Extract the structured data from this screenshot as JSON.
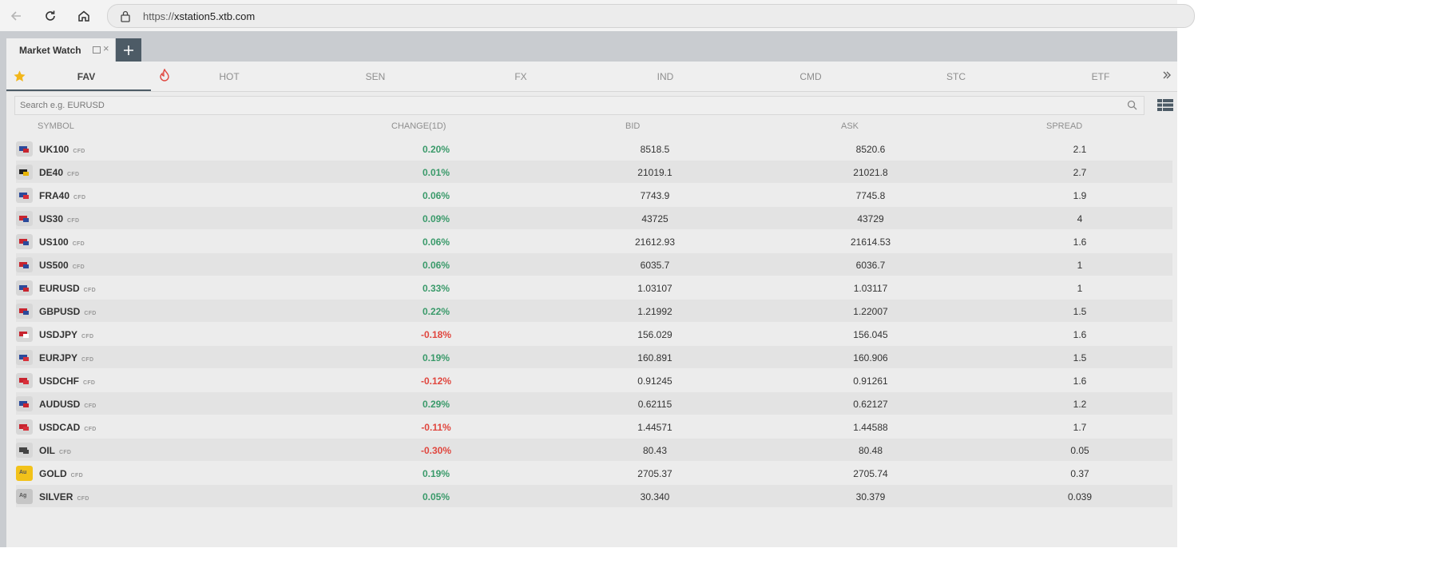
{
  "browser": {
    "url_scheme": "https://",
    "url_host": "xstation5.xtb.com"
  },
  "tabs": {
    "market_watch": "Market Watch"
  },
  "categories": [
    "FAV",
    "HOT",
    "SEN",
    "FX",
    "IND",
    "CMD",
    "STC",
    "ETF"
  ],
  "search": {
    "placeholder": "Search e.g. EURUSD"
  },
  "columns": {
    "symbol": "SYMBOL",
    "change": "CHANGE(1D)",
    "bid": "BID",
    "ask": "ASK",
    "spread": "SPREAD"
  },
  "colors": {
    "positive": "#3a9a6a",
    "negative": "#e0463e",
    "accent": "#4d5b66",
    "star": "#f2b61a"
  },
  "rows": [
    {
      "symbol": "UK100",
      "tag": "CFD",
      "change": "0.20%",
      "dir": "up",
      "bid": "8518.5",
      "ask": "8520.6",
      "spread": "2.1",
      "flag": "uk-flag-icon"
    },
    {
      "symbol": "DE40",
      "tag": "CFD",
      "change": "0.01%",
      "dir": "up",
      "bid": "21019.1",
      "ask": "21021.8",
      "spread": "2.7",
      "flag": "de-flag-icon"
    },
    {
      "symbol": "FRA40",
      "tag": "CFD",
      "change": "0.06%",
      "dir": "up",
      "bid": "7743.9",
      "ask": "7745.8",
      "spread": "1.9",
      "flag": "fr-flag-icon"
    },
    {
      "symbol": "US30",
      "tag": "CFD",
      "change": "0.09%",
      "dir": "up",
      "bid": "43725",
      "ask": "43729",
      "spread": "4",
      "flag": "us-flag-icon"
    },
    {
      "symbol": "US100",
      "tag": "CFD",
      "change": "0.06%",
      "dir": "up",
      "bid": "21612.93",
      "ask": "21614.53",
      "spread": "1.6",
      "flag": "us-flag-icon"
    },
    {
      "symbol": "US500",
      "tag": "CFD",
      "change": "0.06%",
      "dir": "up",
      "bid": "6035.7",
      "ask": "6036.7",
      "spread": "1",
      "flag": "us-flag-icon"
    },
    {
      "symbol": "EURUSD",
      "tag": "CFD",
      "change": "0.33%",
      "dir": "up",
      "bid": "1.03107",
      "ask": "1.03117",
      "spread": "1",
      "flag": "eu-us-flag-icon"
    },
    {
      "symbol": "GBPUSD",
      "tag": "CFD",
      "change": "0.22%",
      "dir": "up",
      "bid": "1.21992",
      "ask": "1.22007",
      "spread": "1.5",
      "flag": "gb-us-flag-icon"
    },
    {
      "symbol": "USDJPY",
      "tag": "CFD",
      "change": "-0.18%",
      "dir": "down",
      "bid": "156.029",
      "ask": "156.045",
      "spread": "1.6",
      "flag": "us-jp-flag-icon"
    },
    {
      "symbol": "EURJPY",
      "tag": "CFD",
      "change": "0.19%",
      "dir": "up",
      "bid": "160.891",
      "ask": "160.906",
      "spread": "1.5",
      "flag": "eu-jp-flag-icon"
    },
    {
      "symbol": "USDCHF",
      "tag": "CFD",
      "change": "-0.12%",
      "dir": "down",
      "bid": "0.91245",
      "ask": "0.91261",
      "spread": "1.6",
      "flag": "us-ch-flag-icon"
    },
    {
      "symbol": "AUDUSD",
      "tag": "CFD",
      "change": "0.29%",
      "dir": "up",
      "bid": "0.62115",
      "ask": "0.62127",
      "spread": "1.2",
      "flag": "au-us-flag-icon"
    },
    {
      "symbol": "USDCAD",
      "tag": "CFD",
      "change": "-0.11%",
      "dir": "down",
      "bid": "1.44571",
      "ask": "1.44588",
      "spread": "1.7",
      "flag": "us-ca-flag-icon"
    },
    {
      "symbol": "OIL",
      "tag": "CFD",
      "change": "-0.30%",
      "dir": "down",
      "bid": "80.43",
      "ask": "80.48",
      "spread": "0.05",
      "flag": "oil-barrel-icon"
    },
    {
      "symbol": "GOLD",
      "tag": "CFD",
      "change": "0.19%",
      "dir": "up",
      "bid": "2705.37",
      "ask": "2705.74",
      "spread": "0.37",
      "flag": "gold-icon",
      "badge": "Au"
    },
    {
      "symbol": "SILVER",
      "tag": "CFD",
      "change": "0.05%",
      "dir": "up",
      "bid": "30.340",
      "ask": "30.379",
      "spread": "0.039",
      "flag": "silver-icon",
      "badge": "Ag"
    }
  ]
}
